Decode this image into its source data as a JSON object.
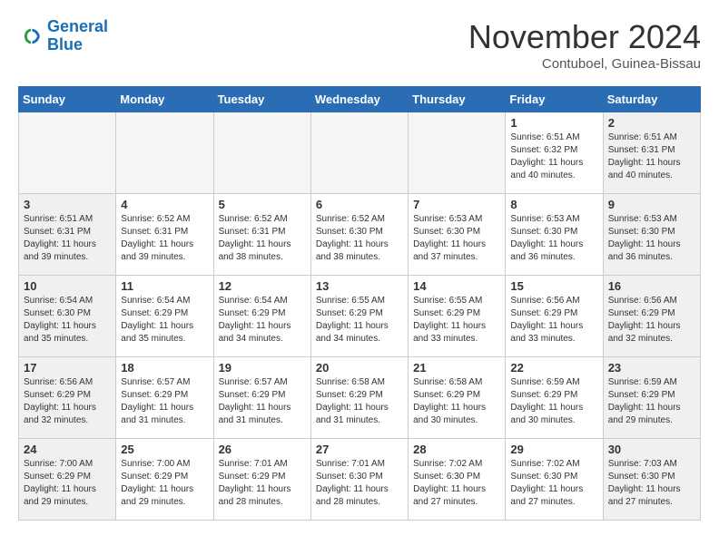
{
  "header": {
    "logo_line1": "General",
    "logo_line2": "Blue",
    "month": "November 2024",
    "location": "Contuboel, Guinea-Bissau"
  },
  "weekdays": [
    "Sunday",
    "Monday",
    "Tuesday",
    "Wednesday",
    "Thursday",
    "Friday",
    "Saturday"
  ],
  "weeks": [
    [
      {
        "day": "",
        "info": "",
        "empty": true
      },
      {
        "day": "",
        "info": "",
        "empty": true
      },
      {
        "day": "",
        "info": "",
        "empty": true
      },
      {
        "day": "",
        "info": "",
        "empty": true
      },
      {
        "day": "",
        "info": "",
        "empty": true
      },
      {
        "day": "1",
        "info": "Sunrise: 6:51 AM\nSunset: 6:32 PM\nDaylight: 11 hours\nand 40 minutes."
      },
      {
        "day": "2",
        "info": "Sunrise: 6:51 AM\nSunset: 6:31 PM\nDaylight: 11 hours\nand 40 minutes."
      }
    ],
    [
      {
        "day": "3",
        "info": "Sunrise: 6:51 AM\nSunset: 6:31 PM\nDaylight: 11 hours\nand 39 minutes."
      },
      {
        "day": "4",
        "info": "Sunrise: 6:52 AM\nSunset: 6:31 PM\nDaylight: 11 hours\nand 39 minutes."
      },
      {
        "day": "5",
        "info": "Sunrise: 6:52 AM\nSunset: 6:31 PM\nDaylight: 11 hours\nand 38 minutes."
      },
      {
        "day": "6",
        "info": "Sunrise: 6:52 AM\nSunset: 6:30 PM\nDaylight: 11 hours\nand 38 minutes."
      },
      {
        "day": "7",
        "info": "Sunrise: 6:53 AM\nSunset: 6:30 PM\nDaylight: 11 hours\nand 37 minutes."
      },
      {
        "day": "8",
        "info": "Sunrise: 6:53 AM\nSunset: 6:30 PM\nDaylight: 11 hours\nand 36 minutes."
      },
      {
        "day": "9",
        "info": "Sunrise: 6:53 AM\nSunset: 6:30 PM\nDaylight: 11 hours\nand 36 minutes."
      }
    ],
    [
      {
        "day": "10",
        "info": "Sunrise: 6:54 AM\nSunset: 6:30 PM\nDaylight: 11 hours\nand 35 minutes."
      },
      {
        "day": "11",
        "info": "Sunrise: 6:54 AM\nSunset: 6:29 PM\nDaylight: 11 hours\nand 35 minutes."
      },
      {
        "day": "12",
        "info": "Sunrise: 6:54 AM\nSunset: 6:29 PM\nDaylight: 11 hours\nand 34 minutes."
      },
      {
        "day": "13",
        "info": "Sunrise: 6:55 AM\nSunset: 6:29 PM\nDaylight: 11 hours\nand 34 minutes."
      },
      {
        "day": "14",
        "info": "Sunrise: 6:55 AM\nSunset: 6:29 PM\nDaylight: 11 hours\nand 33 minutes."
      },
      {
        "day": "15",
        "info": "Sunrise: 6:56 AM\nSunset: 6:29 PM\nDaylight: 11 hours\nand 33 minutes."
      },
      {
        "day": "16",
        "info": "Sunrise: 6:56 AM\nSunset: 6:29 PM\nDaylight: 11 hours\nand 32 minutes."
      }
    ],
    [
      {
        "day": "17",
        "info": "Sunrise: 6:56 AM\nSunset: 6:29 PM\nDaylight: 11 hours\nand 32 minutes."
      },
      {
        "day": "18",
        "info": "Sunrise: 6:57 AM\nSunset: 6:29 PM\nDaylight: 11 hours\nand 31 minutes."
      },
      {
        "day": "19",
        "info": "Sunrise: 6:57 AM\nSunset: 6:29 PM\nDaylight: 11 hours\nand 31 minutes."
      },
      {
        "day": "20",
        "info": "Sunrise: 6:58 AM\nSunset: 6:29 PM\nDaylight: 11 hours\nand 31 minutes."
      },
      {
        "day": "21",
        "info": "Sunrise: 6:58 AM\nSunset: 6:29 PM\nDaylight: 11 hours\nand 30 minutes."
      },
      {
        "day": "22",
        "info": "Sunrise: 6:59 AM\nSunset: 6:29 PM\nDaylight: 11 hours\nand 30 minutes."
      },
      {
        "day": "23",
        "info": "Sunrise: 6:59 AM\nSunset: 6:29 PM\nDaylight: 11 hours\nand 29 minutes."
      }
    ],
    [
      {
        "day": "24",
        "info": "Sunrise: 7:00 AM\nSunset: 6:29 PM\nDaylight: 11 hours\nand 29 minutes."
      },
      {
        "day": "25",
        "info": "Sunrise: 7:00 AM\nSunset: 6:29 PM\nDaylight: 11 hours\nand 29 minutes."
      },
      {
        "day": "26",
        "info": "Sunrise: 7:01 AM\nSunset: 6:29 PM\nDaylight: 11 hours\nand 28 minutes."
      },
      {
        "day": "27",
        "info": "Sunrise: 7:01 AM\nSunset: 6:30 PM\nDaylight: 11 hours\nand 28 minutes."
      },
      {
        "day": "28",
        "info": "Sunrise: 7:02 AM\nSunset: 6:30 PM\nDaylight: 11 hours\nand 27 minutes."
      },
      {
        "day": "29",
        "info": "Sunrise: 7:02 AM\nSunset: 6:30 PM\nDaylight: 11 hours\nand 27 minutes."
      },
      {
        "day": "30",
        "info": "Sunrise: 7:03 AM\nSunset: 6:30 PM\nDaylight: 11 hours\nand 27 minutes."
      }
    ]
  ]
}
